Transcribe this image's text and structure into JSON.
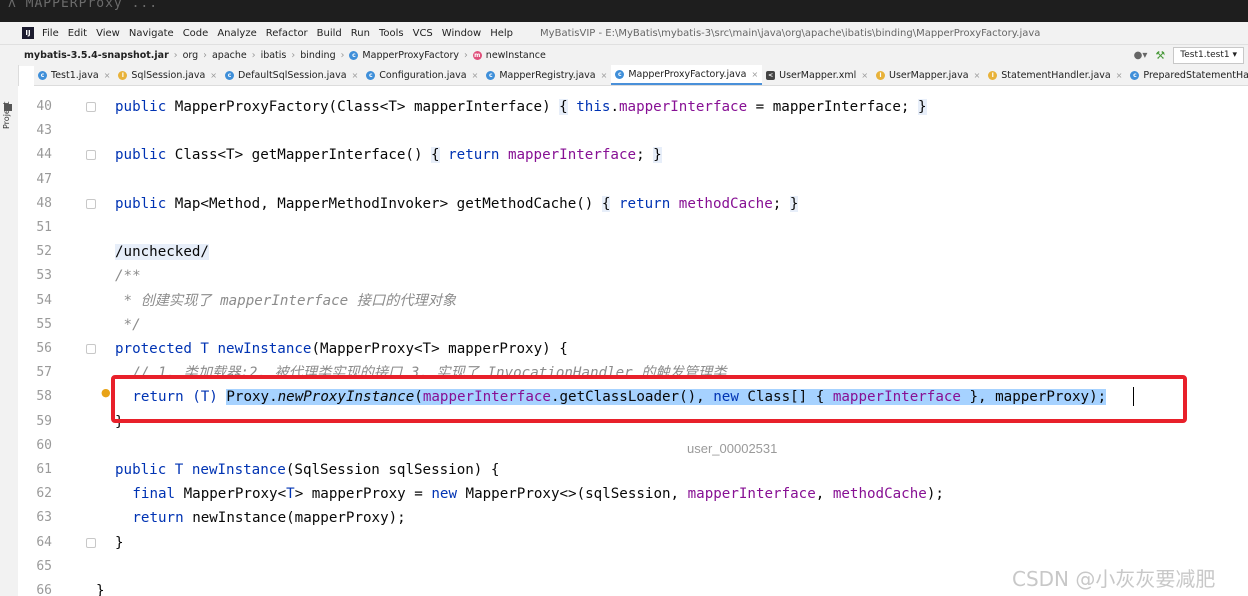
{
  "top_strip_text": "  ʌ   MAPPERProxy   ... ",
  "menubar": {
    "items": [
      "File",
      "Edit",
      "View",
      "Navigate",
      "Code",
      "Analyze",
      "Refactor",
      "Build",
      "Run",
      "Tools",
      "VCS",
      "Window",
      "Help"
    ],
    "window_title": "MyBatisVIP - E:\\MyBatis\\mybatis-3\\src\\main\\java\\org\\apache\\ibatis\\binding\\MapperProxyFactory.java"
  },
  "breadcrumb": [
    {
      "label": "mybatis-3.5.4-snapshot.jar",
      "icon": ""
    },
    {
      "label": "org",
      "icon": ""
    },
    {
      "label": "apache",
      "icon": ""
    },
    {
      "label": "ibatis",
      "icon": ""
    },
    {
      "label": "binding",
      "icon": ""
    },
    {
      "label": "MapperProxyFactory",
      "icon": "c"
    },
    {
      "label": "newInstance",
      "icon": "m"
    }
  ],
  "run_config": "Test1.test1",
  "project_label": "Project",
  "tabs": [
    {
      "label": "Test1.java",
      "icon": "c",
      "active": false
    },
    {
      "label": "SqlSession.java",
      "icon": "j",
      "active": false
    },
    {
      "label": "DefaultSqlSession.java",
      "icon": "c",
      "active": false
    },
    {
      "label": "Configuration.java",
      "icon": "c",
      "active": false
    },
    {
      "label": "MapperRegistry.java",
      "icon": "c",
      "active": false
    },
    {
      "label": "MapperProxyFactory.java",
      "icon": "c",
      "active": true
    },
    {
      "label": "UserMapper.xml",
      "icon": "x",
      "active": false
    },
    {
      "label": "UserMapper.java",
      "icon": "j",
      "active": false
    },
    {
      "label": "StatementHandler.java",
      "icon": "j",
      "active": false
    },
    {
      "label": "PreparedStatementHandler.java",
      "icon": "c",
      "active": false
    }
  ],
  "code_lines": [
    {
      "num": "40",
      "indent": 0,
      "fold": true,
      "tokens": [
        {
          "t": "public ",
          "c": "kw"
        },
        {
          "t": "MapperProxyFactory",
          "c": ""
        },
        {
          "t": "(Class<T> mapperInterface) ",
          "c": ""
        },
        {
          "t": "{",
          "c": "brace"
        },
        {
          "t": " ",
          "c": ""
        },
        {
          "t": "this",
          "c": "kw"
        },
        {
          "t": ".",
          "c": ""
        },
        {
          "t": "mapperInterface",
          "c": "fld"
        },
        {
          "t": " = mapperInterface; ",
          "c": ""
        },
        {
          "t": "}",
          "c": "brace"
        }
      ]
    },
    {
      "num": "43",
      "indent": 0,
      "fold": false,
      "tokens": []
    },
    {
      "num": "44",
      "indent": 0,
      "fold": true,
      "tokens": [
        {
          "t": "public ",
          "c": "kw"
        },
        {
          "t": "Class<T> getMapperInterface() ",
          "c": ""
        },
        {
          "t": "{",
          "c": "brace"
        },
        {
          "t": " ",
          "c": ""
        },
        {
          "t": "return ",
          "c": "kw"
        },
        {
          "t": "mapperInterface",
          "c": "fld"
        },
        {
          "t": "; ",
          "c": ""
        },
        {
          "t": "}",
          "c": "brace"
        }
      ]
    },
    {
      "num": "47",
      "indent": 0,
      "fold": false,
      "tokens": []
    },
    {
      "num": "48",
      "indent": 0,
      "fold": true,
      "tokens": [
        {
          "t": "public ",
          "c": "kw"
        },
        {
          "t": "Map<Method, MapperMethodInvoker> getMethodCache() ",
          "c": ""
        },
        {
          "t": "{",
          "c": "brace"
        },
        {
          "t": " ",
          "c": ""
        },
        {
          "t": "return ",
          "c": "kw"
        },
        {
          "t": "methodCache",
          "c": "fld"
        },
        {
          "t": "; ",
          "c": ""
        },
        {
          "t": "}",
          "c": "brace"
        }
      ]
    },
    {
      "num": "51",
      "indent": 0,
      "fold": false,
      "tokens": []
    },
    {
      "num": "52",
      "indent": 0,
      "fold": false,
      "tokens": [
        {
          "t": "/unchecked/",
          "c": "brace"
        }
      ]
    },
    {
      "num": "53",
      "indent": 0,
      "fold": false,
      "tokens": [
        {
          "t": "/**",
          "c": "cmt"
        }
      ]
    },
    {
      "num": "54",
      "indent": 0,
      "fold": false,
      "tokens": [
        {
          "t": " * 创建实现了 mapperInterface 接口的代理对象",
          "c": "cmt"
        }
      ]
    },
    {
      "num": "55",
      "indent": 0,
      "fold": false,
      "tokens": [
        {
          "t": " */",
          "c": "cmt"
        }
      ]
    },
    {
      "num": "56",
      "indent": 0,
      "fold": true,
      "tokens": [
        {
          "t": "protected ",
          "c": "kw"
        },
        {
          "t": "T ",
          "c": "kw"
        },
        {
          "t": "newInstance",
          "c": "kw"
        },
        {
          "t": "(MapperProxy<T> mapperProxy) {",
          "c": ""
        }
      ]
    },
    {
      "num": "57",
      "indent": 1,
      "fold": false,
      "tokens": [
        {
          "t": "// 1. 类加载器;2. 被代理类实现的接口 3. 实现了 InvocationHandler 的触发管理类",
          "c": "cmt"
        }
      ]
    },
    {
      "num": "58",
      "indent": 1,
      "fold": false,
      "tokens": [
        {
          "t": "return ",
          "c": "kw"
        },
        {
          "t": "(T) ",
          "c": "kw"
        },
        {
          "t": "Proxy.",
          "c": "sel"
        },
        {
          "t": "newProxyInstance",
          "c": "sel it"
        },
        {
          "t": "(",
          "c": "sel"
        },
        {
          "t": "mapperInterface",
          "c": "sel fld"
        },
        {
          "t": ".getClassLoader(), ",
          "c": "sel"
        },
        {
          "t": "new ",
          "c": "sel kw"
        },
        {
          "t": "Class[] { ",
          "c": "sel"
        },
        {
          "t": "mapperInterface",
          "c": "sel fld"
        },
        {
          "t": " }, mapperProxy);",
          "c": "sel"
        }
      ]
    },
    {
      "num": "59",
      "indent": 0,
      "fold": false,
      "tokens": [
        {
          "t": "}",
          "c": ""
        }
      ]
    },
    {
      "num": "60",
      "indent": 0,
      "fold": false,
      "tokens": []
    },
    {
      "num": "61",
      "indent": 0,
      "fold": false,
      "tokens": [
        {
          "t": "public ",
          "c": "kw"
        },
        {
          "t": "T ",
          "c": "kw"
        },
        {
          "t": "newInstance",
          "c": "kw"
        },
        {
          "t": "(SqlSession sqlSession) {",
          "c": ""
        }
      ]
    },
    {
      "num": "62",
      "indent": 1,
      "fold": false,
      "tokens": [
        {
          "t": "final ",
          "c": "kw"
        },
        {
          "t": "MapperProxy<",
          "c": ""
        },
        {
          "t": "T",
          "c": "kw"
        },
        {
          "t": "> mapperProxy = ",
          "c": ""
        },
        {
          "t": "new ",
          "c": "kw"
        },
        {
          "t": "MapperProxy<>(sqlSession, ",
          "c": ""
        },
        {
          "t": "mapperInterface",
          "c": "fld"
        },
        {
          "t": ", ",
          "c": ""
        },
        {
          "t": "methodCache",
          "c": "fld"
        },
        {
          "t": ");",
          "c": ""
        }
      ]
    },
    {
      "num": "63",
      "indent": 1,
      "fold": false,
      "tokens": [
        {
          "t": "return ",
          "c": "kw"
        },
        {
          "t": "newInstance(mapperProxy);",
          "c": ""
        }
      ]
    },
    {
      "num": "64",
      "indent": 0,
      "fold": true,
      "tokens": [
        {
          "t": "}",
          "c": ""
        }
      ]
    },
    {
      "num": "65",
      "indent": 0,
      "fold": false,
      "tokens": []
    },
    {
      "num": "66",
      "indent": -1,
      "fold": false,
      "tokens": [
        {
          "t": "}",
          "c": ""
        }
      ]
    }
  ],
  "watermark_user": "user_00002531",
  "watermark_csdn": "CSDN @小灰灰要减肥"
}
